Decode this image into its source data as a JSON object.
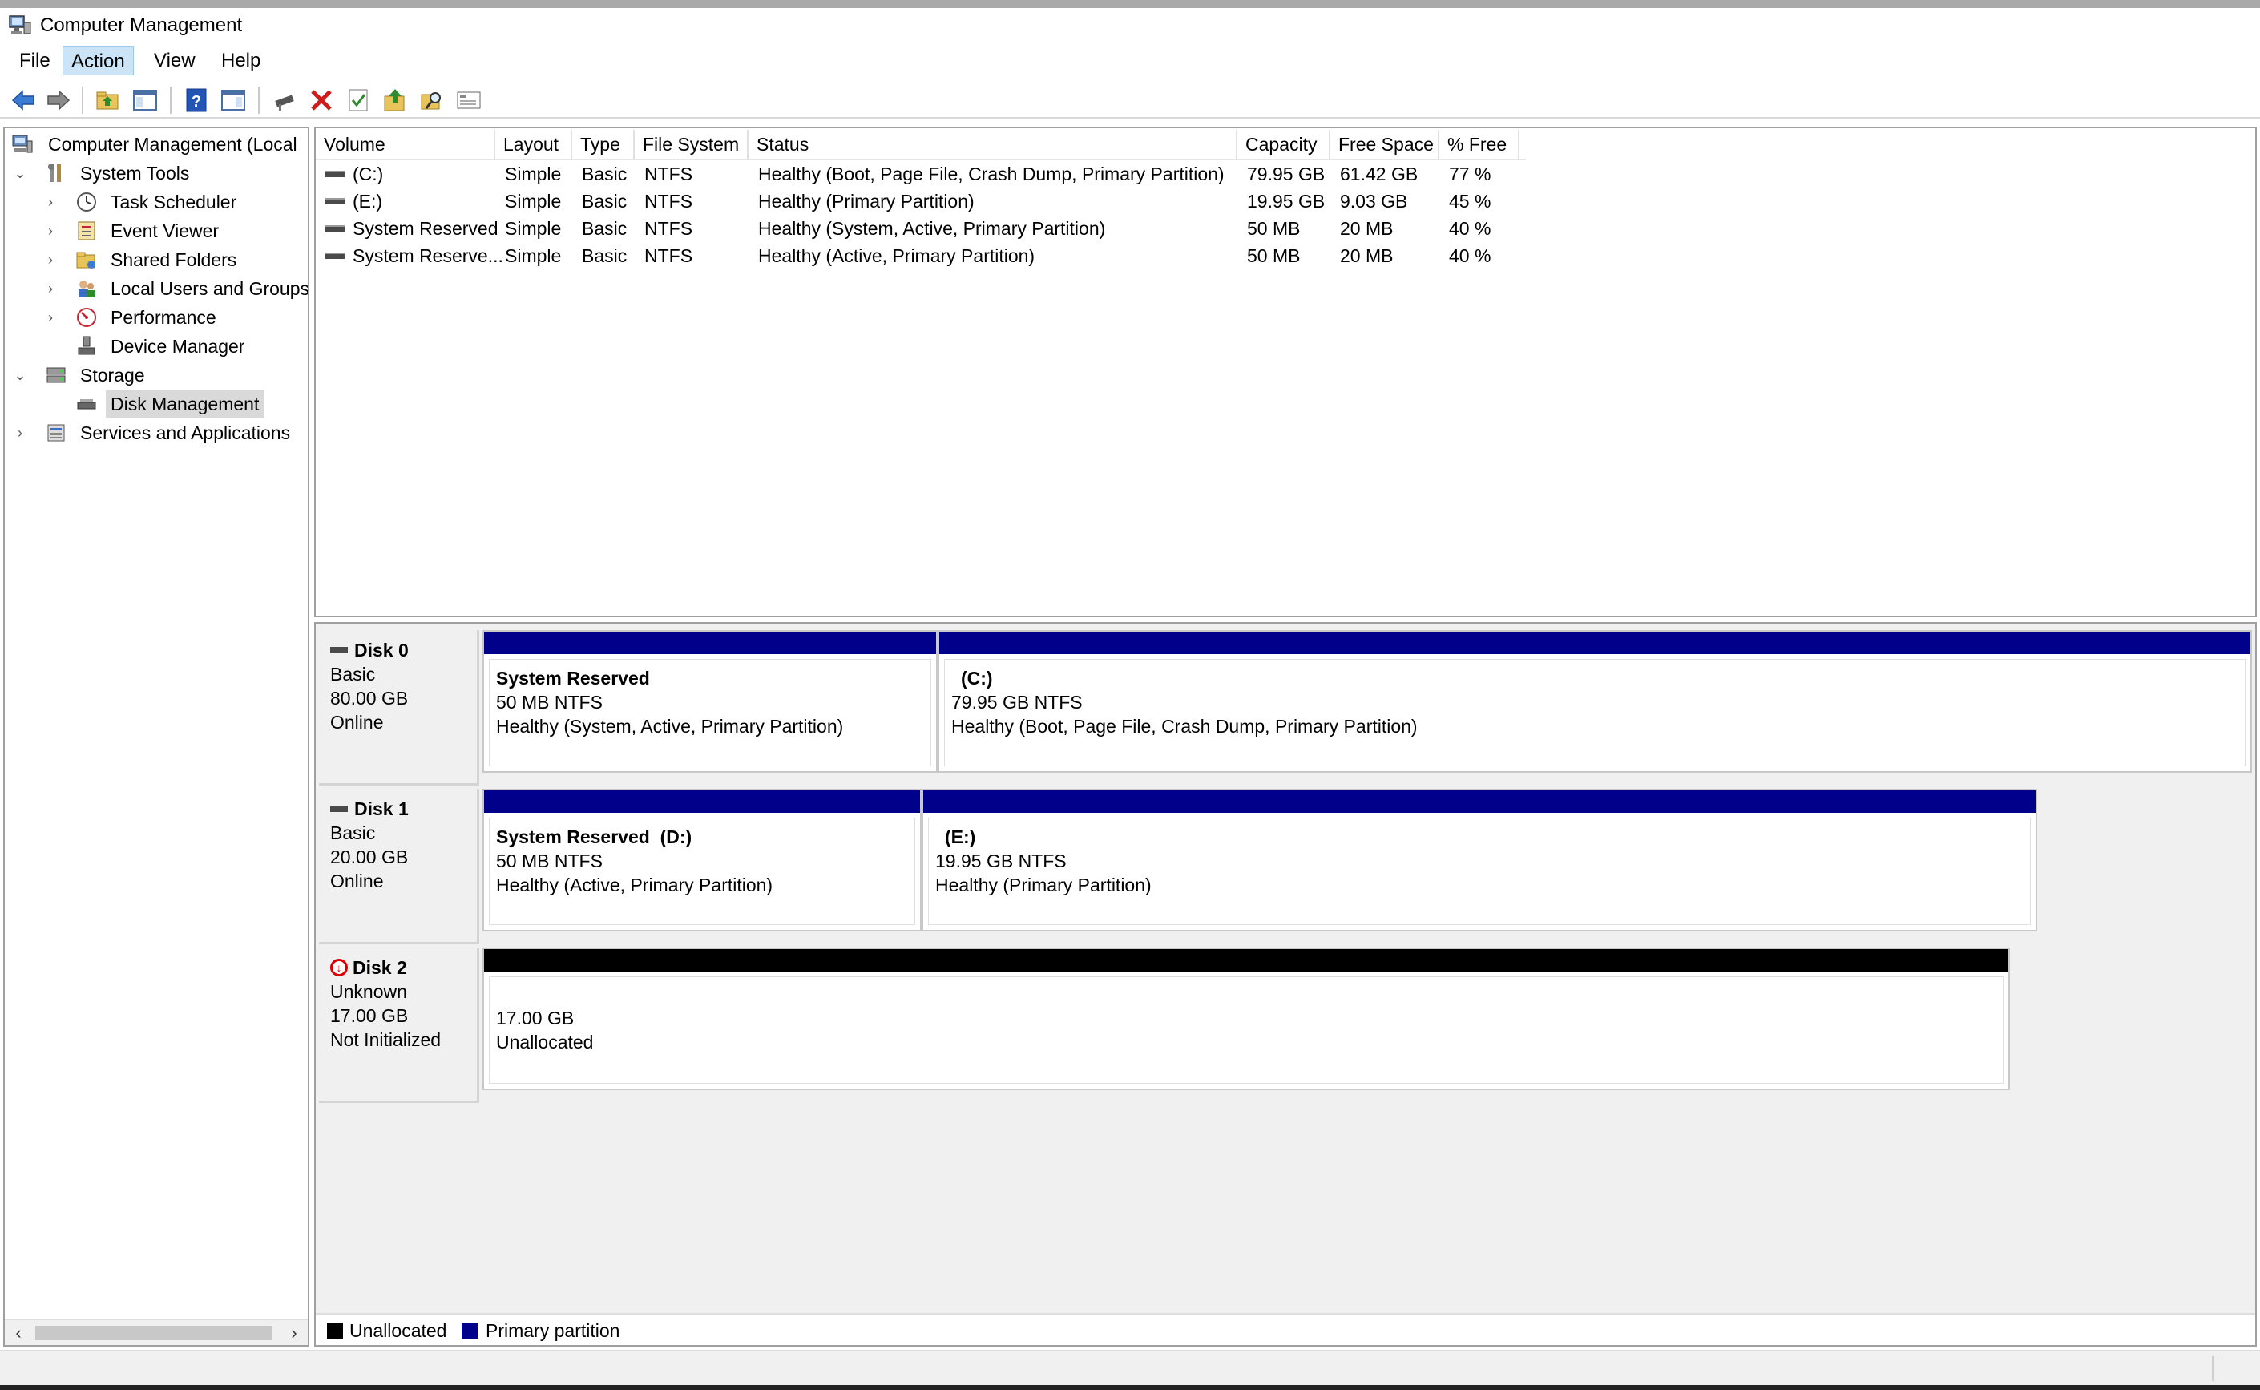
{
  "window": {
    "title": "Computer Management"
  },
  "menu": [
    "File",
    "Action",
    "View",
    "Help"
  ],
  "toolbar": [
    "back-icon",
    "forward-icon",
    "up-folder-icon",
    "show-hide-tree-icon",
    "help-icon",
    "show-hide-action-pane-icon",
    "connect-icon",
    "delete-icon",
    "properties-icon",
    "export-list-icon",
    "search-icon",
    "console-icon"
  ],
  "tree": {
    "root": "Computer Management (Local",
    "system_tools": "System Tools",
    "task_scheduler": "Task Scheduler",
    "event_viewer": "Event Viewer",
    "shared_folders": "Shared Folders",
    "local_users": "Local Users and Groups",
    "performance": "Performance",
    "device_manager": "Device Manager",
    "storage": "Storage",
    "disk_management": "Disk Management",
    "services": "Services and Applications"
  },
  "volumes": {
    "headers": [
      "Volume",
      "Layout",
      "Type",
      "File System",
      "Status",
      "Capacity",
      "Free Space",
      "% Free"
    ],
    "rows": [
      [
        "(C:)",
        "Simple",
        "Basic",
        "NTFS",
        "Healthy (Boot, Page File, Crash Dump, Primary Partition)",
        "79.95 GB",
        "61.42 GB",
        "77 %"
      ],
      [
        "(E:)",
        "Simple",
        "Basic",
        "NTFS",
        "Healthy (Primary Partition)",
        "19.95 GB",
        "9.03 GB",
        "45 %"
      ],
      [
        "System Reserved",
        "Simple",
        "Basic",
        "NTFS",
        "Healthy (System, Active, Primary Partition)",
        "50 MB",
        "20 MB",
        "40 %"
      ],
      [
        "System Reserve...",
        "Simple",
        "Basic",
        "NTFS",
        "Healthy (Active, Primary Partition)",
        "50 MB",
        "20 MB",
        "40 %"
      ]
    ]
  },
  "disks": [
    {
      "name": "Disk 0",
      "type": "Basic",
      "size": "80.00 GB",
      "state": "Online",
      "partitions": [
        {
          "name": "System Reserved",
          "info": "50 MB NTFS",
          "status": "Healthy (System, Active, Primary Partition)"
        },
        {
          "name": "(C:)",
          "info": "79.95 GB NTFS",
          "status": "Healthy (Boot, Page File, Crash Dump, Primary Partition)"
        }
      ]
    },
    {
      "name": "Disk 1",
      "type": "Basic",
      "size": "20.00 GB",
      "state": "Online",
      "partitions": [
        {
          "name": "System Reserved  (D:)",
          "info": "50 MB NTFS",
          "status": "Healthy (Active, Primary Partition)"
        },
        {
          "name": "(E:)",
          "info": "19.95 GB NTFS",
          "status": "Healthy (Primary Partition)"
        }
      ]
    },
    {
      "name": "Disk 2",
      "type": "Unknown",
      "size": "17.00 GB",
      "state": "Not Initialized",
      "partitions": [
        {
          "info": "17.00 GB",
          "status": "Unallocated"
        }
      ]
    }
  ],
  "legend": {
    "unallocated": "Unallocated",
    "primary": "Primary partition"
  },
  "colors": {
    "primary": "#00008b",
    "unallocated": "#000000"
  }
}
